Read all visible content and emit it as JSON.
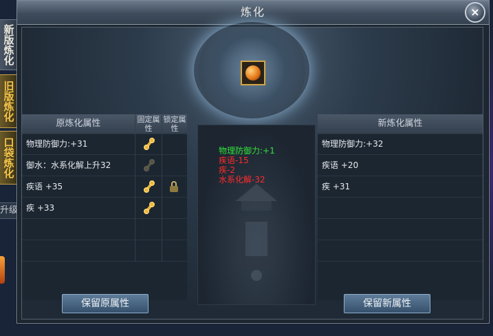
{
  "window": {
    "title": "炼化",
    "close_label": "×"
  },
  "side_tabs": [
    {
      "label": "新版炼化",
      "active": false
    },
    {
      "label": "旧版炼化",
      "active": true
    },
    {
      "label": "口袋炼化",
      "active": true
    }
  ],
  "side_extra": {
    "upgrade_label": "升级"
  },
  "left_panel": {
    "header": "原炼化属性",
    "fixed_header": "固定属性",
    "lock_header": "锁定属性",
    "rows": [
      {
        "text": "物理防御力:+31",
        "fixed": true,
        "lock": false
      },
      {
        "text": "御水：水系化解上升32",
        "fixed": "dim",
        "lock": false
      },
      {
        "text": "疾语 +35",
        "fixed": true,
        "lock": true
      },
      {
        "text": "疾 +33",
        "fixed": true,
        "lock": false
      },
      {
        "text": "",
        "fixed": false,
        "lock": false
      },
      {
        "text": "",
        "fixed": false,
        "lock": false
      }
    ],
    "button": "保留原属性"
  },
  "middle": {
    "diffs": [
      {
        "text": "物理防御力:+1",
        "color": "#33e23a"
      },
      {
        "text": "疾语-15",
        "color": "#ff2b2b"
      },
      {
        "text": "疾-2",
        "color": "#ff2b2b"
      },
      {
        "text": "水系化解-32",
        "color": "#ff2b2b"
      }
    ]
  },
  "right_panel": {
    "header": "新炼化属性",
    "rows": [
      "物理防御力:+32",
      "疾语 +20",
      "疾 +31",
      "",
      "",
      ""
    ],
    "button": "保留新属性"
  },
  "item": {
    "icon": "orange-gem-icon"
  }
}
